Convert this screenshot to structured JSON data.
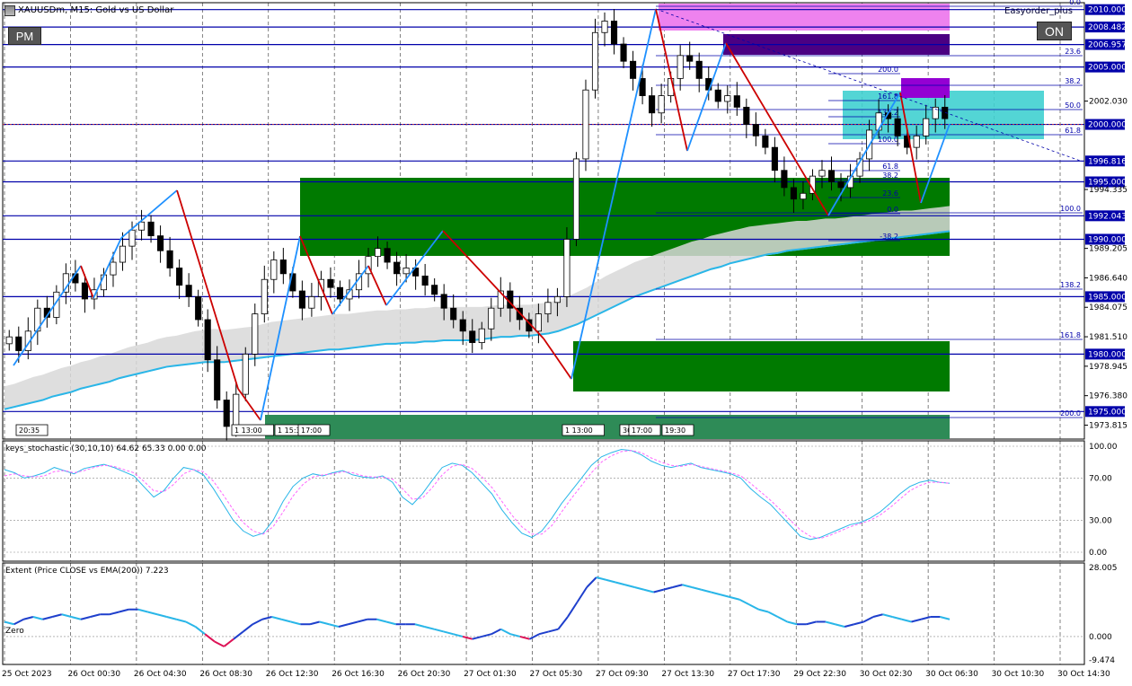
{
  "chart_header": {
    "symbol_title": "XAUUSDm, M15:  Gold vs US Dollar",
    "easyorder_label": "Easyorder_plus",
    "pm_button": "PM",
    "on_button": "ON"
  },
  "colors": {
    "bull_zone": "#007a00",
    "bull_zone_light": "#2e8b57",
    "supply_violet": "#ee82ee",
    "supply_indigo": "#4b0082",
    "fib_box": "#40d0d0",
    "level_line": "#0000aa",
    "down_swing": "#cc0000",
    "up_swing": "#1e90ff",
    "ema_cloud": "#d8d8d8",
    "ema_line": "#29b6e8",
    "stoch_main": "#29b6e8",
    "stoch_signal": "#ff66ff",
    "extent_up": "#1e3fcc",
    "extent_down": "#dd1155"
  },
  "chart_data": [
    {
      "type": "candlestick",
      "title": "XAUUSDm, M15:  Gold vs US Dollar",
      "y_ticks": [
        "2010.000",
        "2008.482",
        "2006.957",
        "2005.000",
        "2002.030",
        "2000.000",
        "1996.816",
        "1995.000",
        "1994.335",
        "1992.043",
        "1990.000",
        "1989.205",
        "1986.640",
        "1985.000",
        "1984.075",
        "1981.510",
        "1980.000",
        "1978.945",
        "1976.380",
        "1975.000",
        "1973.815"
      ],
      "highlighted_levels": [
        "2010.000",
        "2008.482",
        "2006.957",
        "2005.000",
        "2000.000",
        "1996.816",
        "1995.000",
        "1992.043",
        "1990.000",
        "1985.000",
        "1980.000",
        "1975.000"
      ],
      "fib_labels_right": [
        "0.0",
        "23.6",
        "38.2",
        "50.0",
        "61.8",
        "100.0",
        "138.2",
        "161.8",
        "200.0"
      ],
      "fib_labels_inner": [
        "200.0",
        "161.8",
        "138.2",
        "100.0",
        "61.8",
        "38.2",
        "23.6",
        "0.0",
        "-38.2"
      ],
      "time_tags": [
        "20:35",
        "1 13:00",
        "1 15:30",
        "17:00",
        "1 13:00",
        "30",
        "17:00",
        "19:30"
      ],
      "indicator_points": {
        "close": [
          1981.5,
          1980.3,
          1982.0,
          1984.0,
          1983.2,
          1985.4,
          1987.0,
          1986.2,
          1984.8,
          1985.6,
          1986.9,
          1988.0,
          1989.4,
          1990.8,
          1991.5,
          1990.3,
          1989.0,
          1987.5,
          1986.0,
          1985.0,
          1983.0,
          1979.5,
          1976.0,
          1973.7,
          1976.5,
          1980.0,
          1983.5,
          1986.5,
          1988.2,
          1987.0,
          1985.5,
          1984.0,
          1985.0,
          1986.5,
          1985.8,
          1984.8,
          1985.6,
          1987.0,
          1988.5,
          1989.2,
          1988.0,
          1987.0,
          1987.5,
          1986.8,
          1986.0,
          1985.2,
          1984.0,
          1983.0,
          1982.0,
          1981.0,
          1982.2,
          1984.0,
          1985.5,
          1984.0,
          1983.0,
          1982.0,
          1983.5,
          1984.5,
          1985.0,
          1990.0,
          1997.0,
          2003.0,
          2008.0,
          2009.0,
          2007.0,
          2005.5,
          2004.0,
          2002.5,
          2001.0,
          2002.5,
          2004.0,
          2006.0,
          2005.5,
          2004.0,
          2003.0,
          2002.0,
          2002.5,
          2001.5,
          2000.0,
          1999.0,
          1998.0,
          1996.0,
          1994.5,
          1993.5,
          1994.0,
          1995.5,
          1996.0,
          1995.0,
          1994.5,
          1995.5,
          1997.0,
          1999.5,
          2001.0,
          2000.5,
          1999.0,
          1998.0,
          1999.0,
          2000.5,
          2001.5,
          2000.5
        ],
        "ema_cloud_upper": [
          1977.2,
          1977.4,
          1977.7,
          1978.0,
          1978.2,
          1978.5,
          1978.8,
          1979.0,
          1979.3,
          1979.5,
          1979.8,
          1980.0,
          1980.3,
          1980.6,
          1980.8,
          1981.0,
          1981.3,
          1981.5,
          1981.6,
          1981.8,
          1982.0,
          1982.1,
          1982.2,
          1982.1,
          1982.2,
          1982.3,
          1982.4,
          1982.6,
          1982.8,
          1982.9,
          1983.0,
          1983.1,
          1983.2,
          1983.3,
          1983.4,
          1983.5,
          1983.5,
          1983.6,
          1983.7,
          1983.8,
          1983.8,
          1983.9,
          1983.9,
          1984.0,
          1984.0,
          1984.1,
          1984.1,
          1984.1,
          1984.1,
          1984.1,
          1984.1,
          1984.2,
          1984.3,
          1984.3,
          1984.3,
          1984.3,
          1984.4,
          1984.5,
          1984.7,
          1985.0,
          1985.4,
          1985.8,
          1986.3,
          1986.8,
          1987.2,
          1987.6,
          1988.0,
          1988.3,
          1988.6,
          1988.9,
          1989.2,
          1989.5,
          1989.8,
          1990.0,
          1990.3,
          1990.5,
          1990.7,
          1990.9,
          1991.1,
          1991.2,
          1991.3,
          1991.4,
          1991.5,
          1991.6,
          1991.6,
          1991.7,
          1991.8,
          1991.8,
          1991.9,
          1992.0,
          1992.1,
          1992.2,
          1992.3,
          1992.4,
          1992.5,
          1992.5,
          1992.6,
          1992.7,
          1992.8,
          1992.9
        ],
        "ema_line": [
          1975.2,
          1975.4,
          1975.6,
          1975.8,
          1976.0,
          1976.3,
          1976.5,
          1976.7,
          1977.0,
          1977.2,
          1977.4,
          1977.6,
          1977.9,
          1978.1,
          1978.3,
          1978.5,
          1978.7,
          1978.9,
          1979.0,
          1979.1,
          1979.2,
          1979.3,
          1979.3,
          1979.3,
          1979.4,
          1979.5,
          1979.6,
          1979.7,
          1979.8,
          1979.9,
          1980.0,
          1980.1,
          1980.2,
          1980.3,
          1980.4,
          1980.4,
          1980.5,
          1980.6,
          1980.7,
          1980.8,
          1980.9,
          1980.9,
          1981.0,
          1981.0,
          1981.1,
          1981.1,
          1981.2,
          1981.2,
          1981.2,
          1981.2,
          1981.3,
          1981.4,
          1981.5,
          1981.5,
          1981.6,
          1981.6,
          1981.7,
          1981.8,
          1982.0,
          1982.3,
          1982.6,
          1983.0,
          1983.4,
          1983.8,
          1984.2,
          1984.6,
          1985.0,
          1985.3,
          1985.6,
          1985.9,
          1986.2,
          1986.5,
          1986.8,
          1987.1,
          1987.4,
          1987.6,
          1987.9,
          1988.1,
          1988.3,
          1988.5,
          1988.7,
          1988.8,
          1989.0,
          1989.1,
          1989.2,
          1989.3,
          1989.4,
          1989.5,
          1989.6,
          1989.7,
          1989.8,
          1989.9,
          1990.0,
          1990.1,
          1990.2,
          1990.3,
          1990.4,
          1990.5,
          1990.6,
          1990.7
        ]
      }
    },
    {
      "type": "line",
      "title": "keys_stochastic (30,10,10) 64.62 65.33 0.00 0.00",
      "y_ticks": [
        "100.00",
        "70.00",
        "30.00",
        "0.00"
      ],
      "ylim": [
        0,
        100
      ],
      "series": [
        {
          "values": [
            78,
            75,
            70,
            72,
            75,
            80,
            77,
            74,
            79,
            81,
            83,
            80,
            76,
            72,
            62,
            52,
            58,
            70,
            80,
            78,
            73,
            60,
            45,
            30,
            20,
            15,
            18,
            30,
            48,
            62,
            70,
            74,
            72,
            75,
            77,
            73,
            71,
            70,
            72,
            66,
            52,
            45,
            55,
            68,
            80,
            84,
            82,
            75,
            65,
            55,
            40,
            28,
            18,
            14,
            20,
            32,
            46,
            58,
            70,
            82,
            90,
            94,
            97,
            96,
            92,
            86,
            82,
            80,
            82,
            84,
            80,
            78,
            76,
            74,
            70,
            60,
            52,
            45,
            35,
            25,
            15,
            12,
            14,
            18,
            22,
            26,
            28,
            32,
            38,
            46,
            55,
            62,
            66,
            68,
            66,
            65
          ]
        },
        {
          "values": [
            72,
            74,
            72,
            71,
            72,
            76,
            77,
            75,
            77,
            80,
            82,
            81,
            78,
            75,
            67,
            58,
            57,
            64,
            74,
            78,
            76,
            67,
            54,
            40,
            28,
            20,
            17,
            24,
            38,
            53,
            64,
            71,
            73,
            74,
            76,
            75,
            72,
            71,
            71,
            69,
            60,
            50,
            51,
            61,
            73,
            81,
            83,
            79,
            71,
            61,
            48,
            35,
            24,
            17,
            17,
            25,
            38,
            51,
            63,
            75,
            85,
            91,
            95,
            96,
            94,
            89,
            85,
            82,
            81,
            83,
            81,
            79,
            77,
            75,
            72,
            65,
            57,
            49,
            40,
            30,
            21,
            15,
            13,
            16,
            20,
            24,
            27,
            30,
            35,
            42,
            50,
            58,
            63,
            66,
            66,
            65
          ]
        }
      ]
    },
    {
      "type": "line",
      "title": "Extent (Price CLOSE vs EMA(200)) 7.223",
      "y_ticks": [
        "28.005",
        "0.000",
        "-9.474"
      ],
      "zero_label": "Zero",
      "ylim": [
        -9.474,
        28.005
      ],
      "series": [
        {
          "values": [
            6,
            5,
            7,
            8,
            7,
            8,
            9,
            8,
            7,
            8,
            9,
            9,
            10,
            11,
            11,
            10,
            9,
            8,
            7,
            6,
            4,
            1,
            -2,
            -4,
            -1,
            2,
            5,
            7,
            8,
            7,
            6,
            5,
            5,
            6,
            5,
            4,
            5,
            6,
            7,
            7,
            6,
            5,
            5,
            5,
            4,
            3,
            2,
            1,
            0,
            -1,
            0,
            1,
            3,
            1,
            0,
            -1,
            1,
            2,
            3,
            8,
            14,
            20,
            24,
            23,
            22,
            21,
            20,
            19,
            18,
            19,
            20,
            21,
            20,
            19,
            18,
            17,
            16,
            15,
            13,
            11,
            10,
            8,
            6,
            5,
            5,
            6,
            6,
            5,
            4,
            5,
            6,
            8,
            9,
            8,
            7,
            6,
            7,
            8,
            8,
            7
          ]
        }
      ]
    }
  ],
  "time_axis": [
    "25 Oct 2023",
    "26 Oct 00:30",
    "26 Oct 04:30",
    "26 Oct 08:30",
    "26 Oct 12:30",
    "26 Oct 16:30",
    "26 Oct 20:30",
    "27 Oct 01:30",
    "27 Oct 05:30",
    "27 Oct 09:30",
    "27 Oct 13:30",
    "27 Oct 17:30",
    "29 Oct 22:30",
    "30 Oct 02:30",
    "30 Oct 06:30",
    "30 Oct 10:30",
    "30 Oct 14:30"
  ]
}
